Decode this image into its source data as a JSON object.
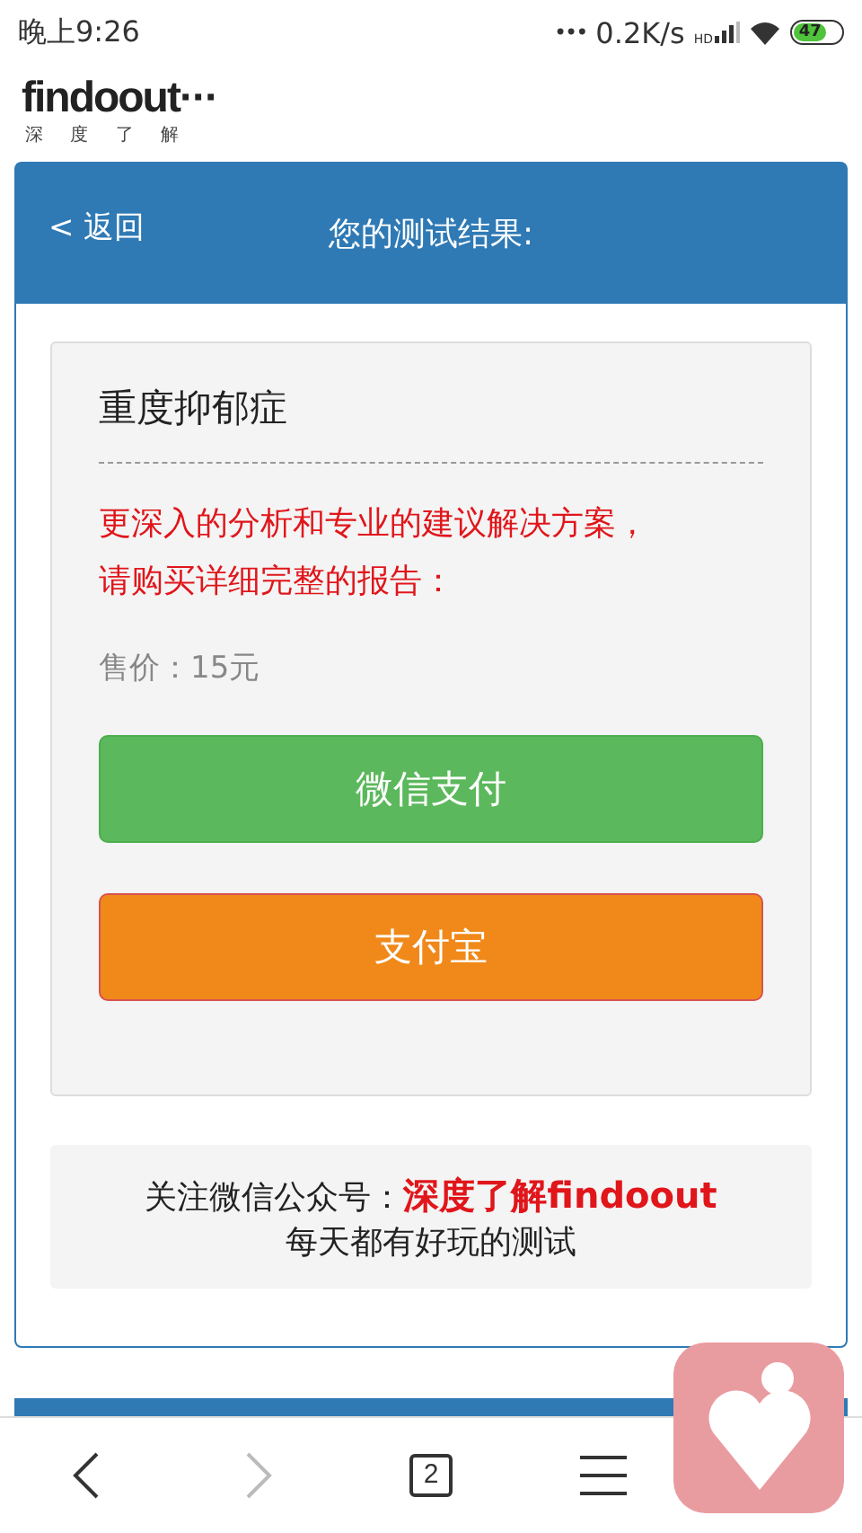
{
  "status_bar": {
    "time": "晚上9:26",
    "dots": "•••",
    "speed": "0.2K/s",
    "network": "HD",
    "battery": "47"
  },
  "logo": {
    "name": "findoout···",
    "subtitle": "深 度 了 解"
  },
  "header": {
    "back": "< 返回",
    "title": "您的测试结果:"
  },
  "result": {
    "title": "重度抑郁症",
    "message": "更深入的分析和专业的建议解决方案，请购买详细完整的报告：",
    "price": "售价：15元"
  },
  "pay_buttons": [
    {
      "label": "微信支付",
      "kind": "wechat"
    },
    {
      "label": "支付宝",
      "kind": "alipay"
    }
  ],
  "follow": {
    "prefix": "关注微信公众号：",
    "account": "深度了解findoout",
    "tagline": "每天都有好玩的测试"
  },
  "nav": {
    "back_disabled": false,
    "forward_disabled": true,
    "tabs": "2"
  }
}
